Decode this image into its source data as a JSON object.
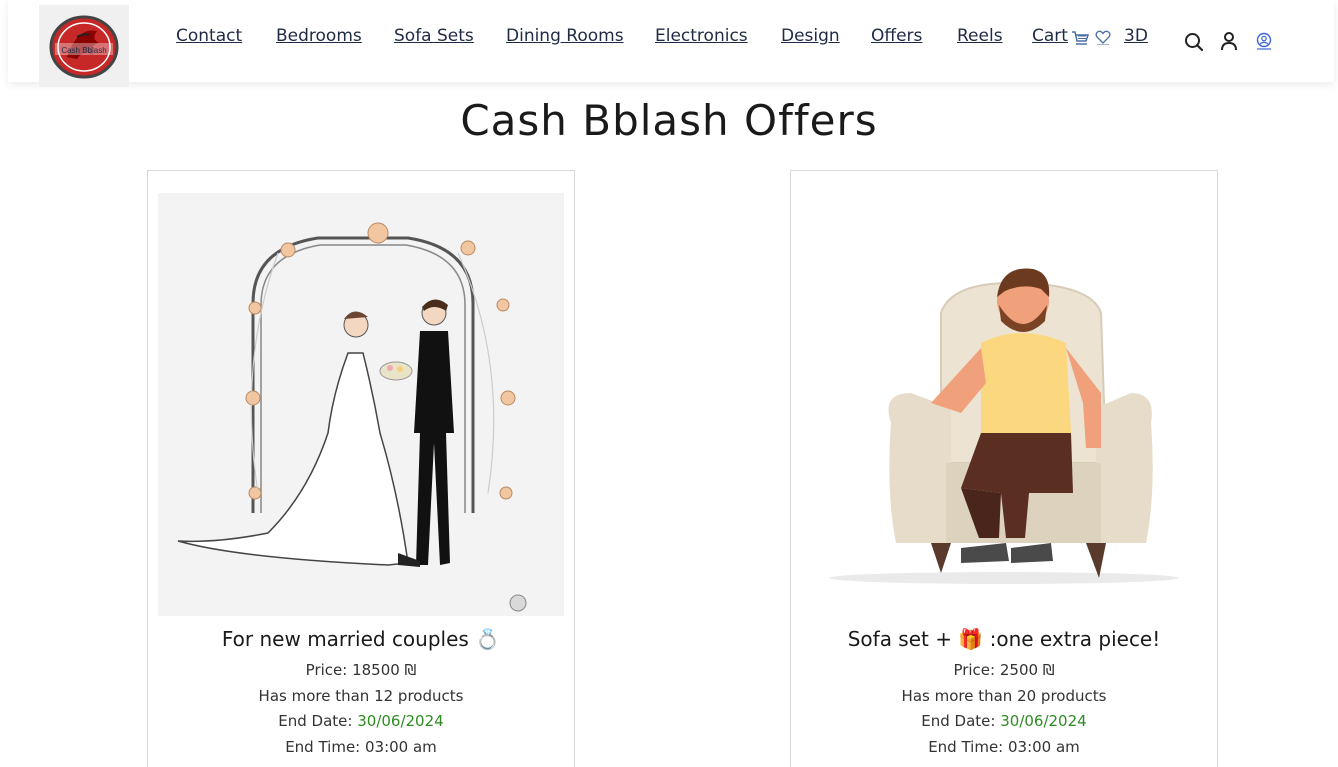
{
  "nav": {
    "logo_text": "Cash Bblash",
    "links": [
      "Contact",
      "Bedrooms",
      "Sofa Sets",
      "Dining Rooms",
      "Electronics",
      "Design",
      "Offers",
      "Reels",
      "Cart",
      "3D"
    ],
    "icons": [
      "cart-icon",
      "heart-icon",
      "search-icon",
      "user-icon",
      "account-circle-icon"
    ]
  },
  "page": {
    "title": "Cash Bblash Offers"
  },
  "offers": [
    {
      "title": "For new married couples 💍",
      "price": "Price: 18500 ₪",
      "products": "Has more than 12 products",
      "end_date_label": "End Date: ",
      "end_date": "30/06/2024",
      "end_time": "End Time: 03:00 am"
    },
    {
      "title": "Sofa set + 🎁 :one extra piece!",
      "price": "Price: 2500 ₪",
      "products": "Has more than 20 products",
      "end_date_label": "End Date: ",
      "end_date": "30/06/2024",
      "end_time": "End Time: 03:00 am"
    }
  ],
  "colors": {
    "nav_text": "#1f2a44",
    "date_green": "#2e8b22",
    "brand_red": "#c62828"
  }
}
